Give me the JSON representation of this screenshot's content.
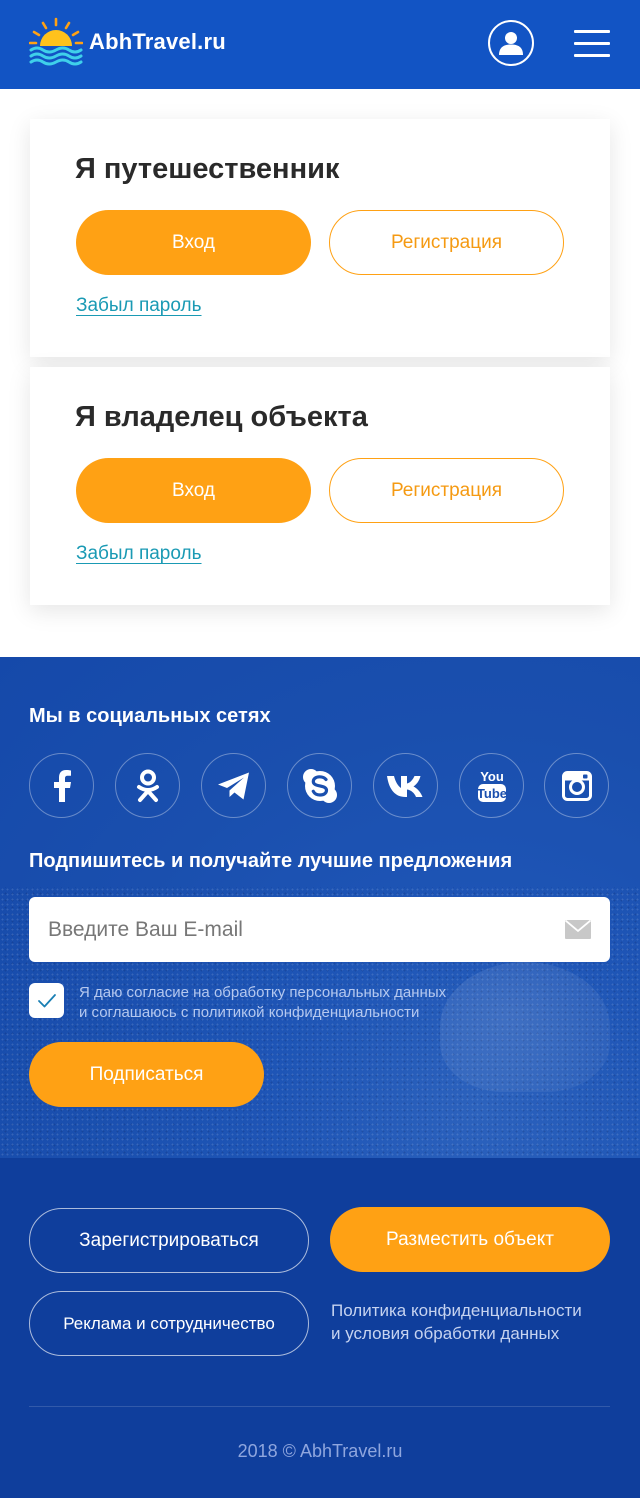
{
  "header": {
    "brand": "AbhTravel.ru",
    "logo_icon": "sun-over-waves-logo",
    "user_icon": "user-icon",
    "menu_icon": "hamburger-menu-icon"
  },
  "traveler": {
    "title": "Я путешественник",
    "login_label": "Вход",
    "register_label": "Регистрация",
    "forgot_label": "Забыл пароль"
  },
  "owner": {
    "title": "Я владелец объекта",
    "login_label": "Вход",
    "register_label": "Регистрация",
    "forgot_label": "Забыл пароль"
  },
  "social": {
    "title": "Мы в социальных сетях",
    "networks": [
      "facebook-icon",
      "odnoklassniki-icon",
      "telegram-icon",
      "skype-icon",
      "vk-icon",
      "youtube-icon",
      "instagram-icon"
    ]
  },
  "subscribe": {
    "title": "Подпишитесь и получайте лучшие предложения",
    "email_placeholder": "Введите Ваш E-mail",
    "consent_line1": "Я даю согласие на обработку персональных данных",
    "consent_line2": "и соглашаюсь с политикой конфиденциальности",
    "consent_checked": true,
    "button_label": "Подписаться"
  },
  "footer": {
    "register_label": "Зарегистрироваться",
    "place_object_label": "Разместить объект",
    "ads_label": "Реклама и сотрудничество",
    "policy_line1": "Политика конфиденциальности",
    "policy_line2": "и условия обработки данных",
    "copyright": "2018 © AbhTravel.ru"
  },
  "colors": {
    "brand_blue": "#1254c4",
    "accent_orange": "#ffa114",
    "link_teal": "#1a9ab4",
    "footer_blue": "#0f3e9c"
  }
}
